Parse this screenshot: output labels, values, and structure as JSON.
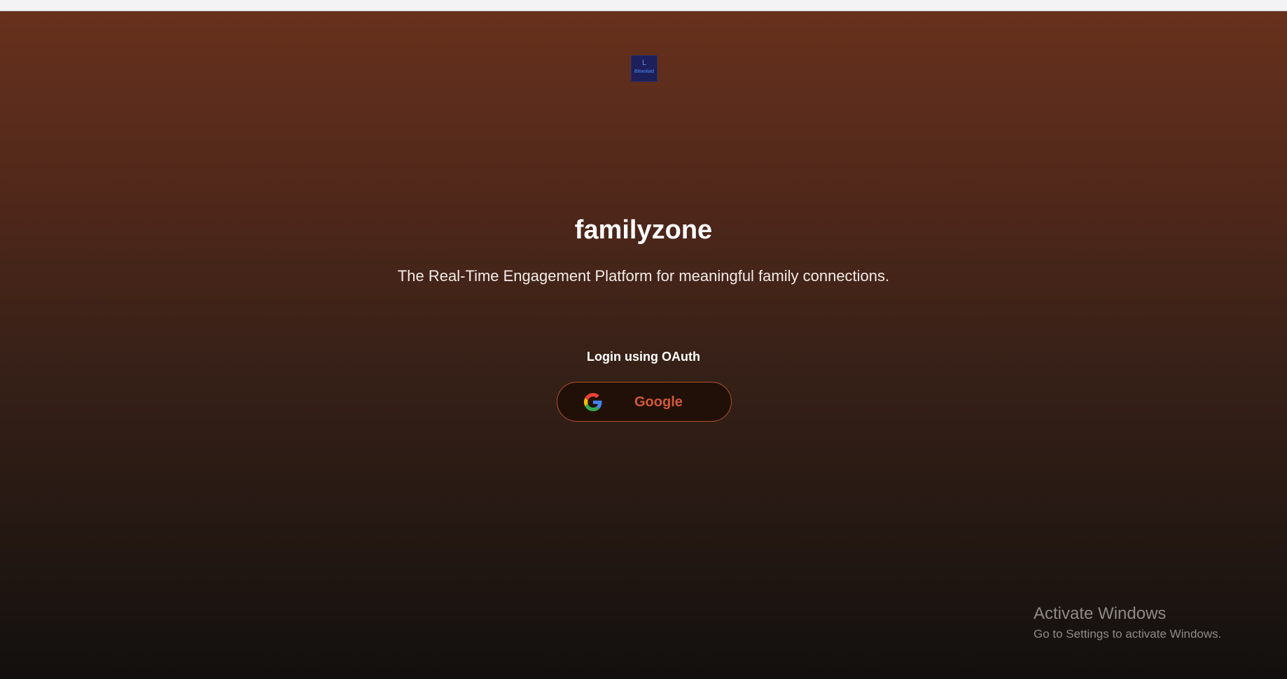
{
  "logo": {
    "letter": "L",
    "word": "Bitwoliad",
    "tag": "........"
  },
  "app": {
    "title": "familyzone",
    "tagline": "The Real-Time Engagement Platform for meaningful family connections."
  },
  "login": {
    "label": "Login using OAuth",
    "providers": [
      {
        "name": "Google",
        "icon": "google-icon"
      }
    ]
  },
  "windows_watermark": {
    "title": "Activate Windows",
    "subtitle": "Go to Settings to activate Windows."
  },
  "colors": {
    "background_top": "#67311d",
    "background_bottom": "#12100e",
    "button_border": "#b0522a",
    "button_text": "#d05a3a",
    "logo_bg": "#1c1f5a"
  }
}
